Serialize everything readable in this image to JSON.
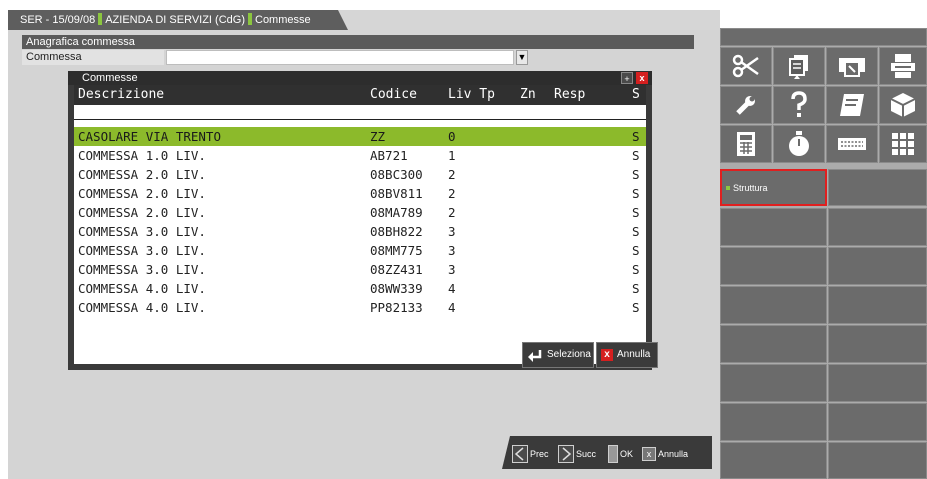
{
  "tab": {
    "part1": "SER - 15/09/08",
    "part2": "AZIENDA DI SERVIZI (CdG)",
    "part3": "Commesse"
  },
  "form": {
    "section_title": "Anagrafica commessa",
    "field_label": "Commessa",
    "field_value": ""
  },
  "dialog": {
    "title": "Commesse",
    "columns": {
      "descrizione": "Descrizione",
      "codice": "Codice",
      "liv_tp": "Liv Tp",
      "zn": "Zn",
      "resp": "Resp",
      "s": "S"
    },
    "rows": [
      {
        "descrizione": "CASOLARE VIA TRENTO",
        "codice": "ZZ",
        "liv": "0",
        "s": "S",
        "selected": true
      },
      {
        "descrizione": "COMMESSA 1.0 LIV.",
        "codice": "AB721",
        "liv": "1",
        "s": "S"
      },
      {
        "descrizione": "COMMESSA 2.0 LIV.",
        "codice": "08BC300",
        "liv": "2",
        "s": "S"
      },
      {
        "descrizione": "COMMESSA 2.0 LIV.",
        "codice": "08BV811",
        "liv": "2",
        "s": "S"
      },
      {
        "descrizione": "COMMESSA 2.0 LIV.",
        "codice": "08MA789",
        "liv": "2",
        "s": "S"
      },
      {
        "descrizione": "COMMESSA 3.0 LIV.",
        "codice": "08BH822",
        "liv": "3",
        "s": "S"
      },
      {
        "descrizione": "COMMESSA 3.0 LIV.",
        "codice": "08MM775",
        "liv": "3",
        "s": "S"
      },
      {
        "descrizione": "COMMESSA 3.0 LIV.",
        "codice": "08ZZ431",
        "liv": "3",
        "s": "S"
      },
      {
        "descrizione": "COMMESSA 4.0 LIV.",
        "codice": "08WW339",
        "liv": "4",
        "s": "S"
      },
      {
        "descrizione": "COMMESSA 4.0 LIV.",
        "codice": "PP82133",
        "liv": "4",
        "s": "S"
      }
    ],
    "seleziona_label": "Seleziona",
    "annulla_label": "Annulla"
  },
  "bottom_nav": {
    "prec": "Prec",
    "succ": "Succ",
    "ok": "OK",
    "annulla": "Annulla"
  },
  "right_panel": {
    "icons": [
      "scissors-icon",
      "copy-doc-icon",
      "print-preview-icon",
      "printer-icon",
      "wrench-icon",
      "help-icon",
      "notes-icon",
      "cube-icon",
      "calculator-icon",
      "stopwatch-icon",
      "keyboard-icon",
      "grid-icon"
    ],
    "struttura_label": "Struttura"
  },
  "colors": {
    "accent_green": "#8cba2b",
    "close_red": "#d51f1f",
    "highlight_border": "#e01f1f"
  }
}
